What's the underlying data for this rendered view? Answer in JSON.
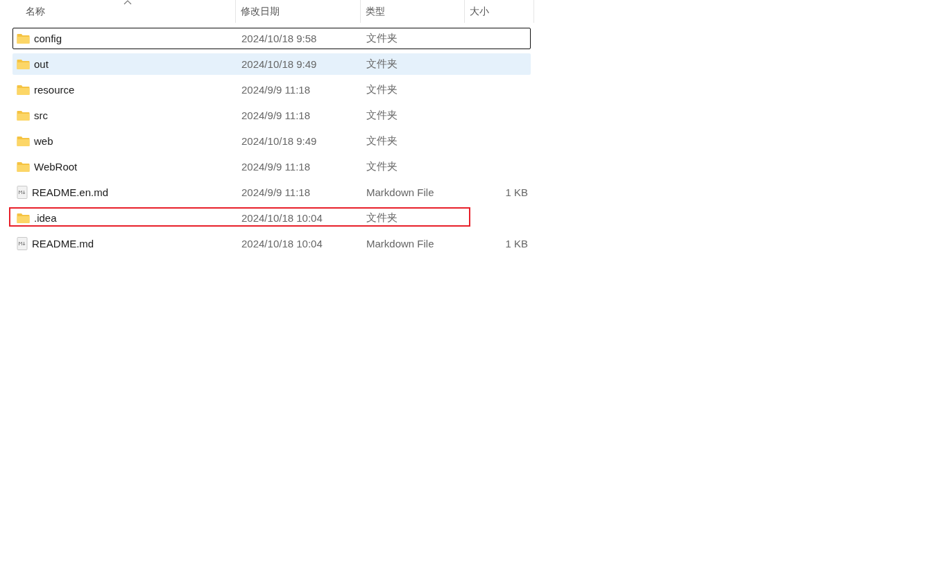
{
  "columns": [
    {
      "label": "名称",
      "sorted": true
    },
    {
      "label": "修改日期",
      "sorted": false
    },
    {
      "label": "类型",
      "sorted": false
    },
    {
      "label": "大小",
      "sorted": false
    }
  ],
  "rows": [
    {
      "kind": "folder",
      "name": "config",
      "date": "2024/10/18 9:58",
      "type": "文件夹",
      "focused": true,
      "selected": false,
      "marked": false
    },
    {
      "kind": "folder",
      "name": "out",
      "date": "2024/10/18 9:49",
      "type": "文件夹",
      "focused": false,
      "selected": true,
      "marked": false
    },
    {
      "kind": "folder",
      "name": "resource",
      "date": "2024/9/9 11:18",
      "type": "文件夹",
      "focused": false,
      "selected": false,
      "marked": false
    },
    {
      "kind": "folder",
      "name": "src",
      "date": "2024/9/9 11:18",
      "type": "文件夹",
      "focused": false,
      "selected": false,
      "marked": false
    },
    {
      "kind": "folder",
      "name": "web",
      "date": "2024/10/18 9:49",
      "type": "文件夹",
      "focused": false,
      "selected": false,
      "marked": false
    },
    {
      "kind": "folder",
      "name": "WebRoot",
      "date": "2024/9/9 11:18",
      "type": "文件夹",
      "focused": false,
      "selected": false,
      "marked": false
    },
    {
      "kind": "markdown",
      "name": "README.en.md",
      "date": "2024/9/9 11:18",
      "type": "Markdown File",
      "size": "1 KB",
      "focused": false,
      "selected": false,
      "marked": false
    },
    {
      "kind": "folder",
      "name": ".idea",
      "date": "2024/10/18 10:04",
      "type": "文件夹",
      "focused": false,
      "selected": false,
      "marked": true
    },
    {
      "kind": "markdown",
      "name": "README.md",
      "date": "2024/10/18 10:04",
      "type": "Markdown File",
      "size": "1 KB",
      "focused": false,
      "selected": false,
      "marked": false
    }
  ]
}
